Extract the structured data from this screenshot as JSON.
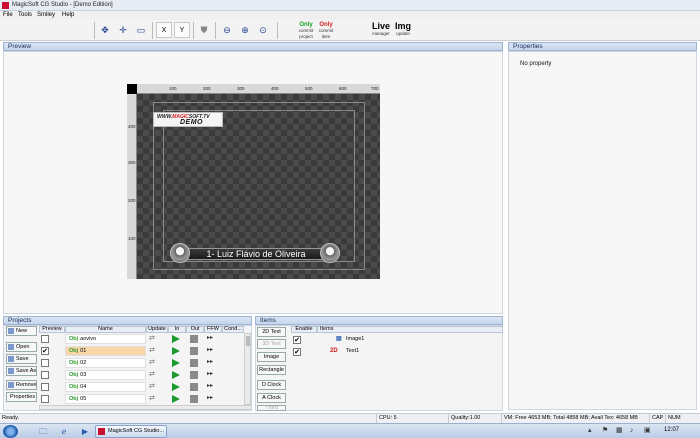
{
  "window": {
    "title": "MagicSoft CG Studio - [Demo Edition]"
  },
  "menu": [
    "File",
    "Tools",
    "Smiley",
    "Help"
  ],
  "toolbar": {
    "commit_project": {
      "top": "Only",
      "mid": "commit",
      "bot": "project"
    },
    "commit_item": {
      "top": "Only",
      "mid": "commit",
      "bot": "item"
    },
    "live": {
      "top": "Live",
      "bot": "manager"
    },
    "img": {
      "top": "Img",
      "bot": "update"
    },
    "x_label": "X",
    "y_label": "Y"
  },
  "preview": {
    "header": "Preview",
    "ruler_top": [
      "100",
      "200",
      "300",
      "400",
      "500",
      "600",
      "700"
    ],
    "ruler_left": [
      "400",
      "300",
      "200",
      "100"
    ],
    "logo_line1_a": "WWW.",
    "logo_line1_b": "MAGIC",
    "logo_line1_c": "SOFT.TV",
    "logo_line2": "DEMO",
    "lower_third_text": "1- Luiz Flávio de Oliveira"
  },
  "properties": {
    "header": "Properties",
    "empty_text": "No property"
  },
  "projects": {
    "header": "Projects",
    "buttons": [
      "New",
      "Open",
      "Save",
      "Save As",
      "Remove",
      "Properties"
    ],
    "columns": [
      "Preview",
      "Name",
      "Update",
      "In",
      "Out",
      "FFW",
      "Cond..."
    ],
    "rows": [
      {
        "checked": false,
        "obj": "Obj",
        "name": "aovivo",
        "selected": false
      },
      {
        "checked": true,
        "obj": "Obj",
        "name": "01",
        "selected": true
      },
      {
        "checked": false,
        "obj": "Obj",
        "name": "02",
        "selected": false
      },
      {
        "checked": false,
        "obj": "Obj",
        "name": "03",
        "selected": false
      },
      {
        "checked": false,
        "obj": "Obj",
        "name": "04",
        "selected": false
      },
      {
        "checked": false,
        "obj": "Obj",
        "name": "05",
        "selected": false
      }
    ]
  },
  "items": {
    "header": "Items",
    "buttons": [
      {
        "label": "2D Text",
        "disabled": false
      },
      {
        "label": "3D Text",
        "disabled": true
      },
      {
        "label": "Image",
        "disabled": false
      },
      {
        "label": "Rectangle",
        "disabled": false
      },
      {
        "label": "D Clock",
        "disabled": false
      },
      {
        "label": "A Clock",
        "disabled": false
      },
      {
        "label": "Third",
        "disabled": true
      }
    ],
    "columns": [
      "Enable",
      "Items"
    ],
    "rows": [
      {
        "checked": true,
        "icon": "image-icon",
        "label": "Image1"
      },
      {
        "checked": true,
        "icon": "2d-text-icon",
        "icon_text": "2D",
        "label": "Text1"
      }
    ]
  },
  "statusbar": {
    "ready": "Ready.",
    "cpu": "CPU: 5",
    "quality": "Quality:1.00",
    "memory": "VM: Free 4653 MB; Total 4858 MB; Avail Tex: 4658 MB",
    "cap": "CAP",
    "num": "NUM"
  },
  "taskbar": {
    "task_label": "MagicSoft CG Studio...",
    "clock": "12:07"
  },
  "colors": {
    "accent_green": "#11a31b",
    "accent_red": "#d41818",
    "selected_row": "#f9d6a8"
  }
}
